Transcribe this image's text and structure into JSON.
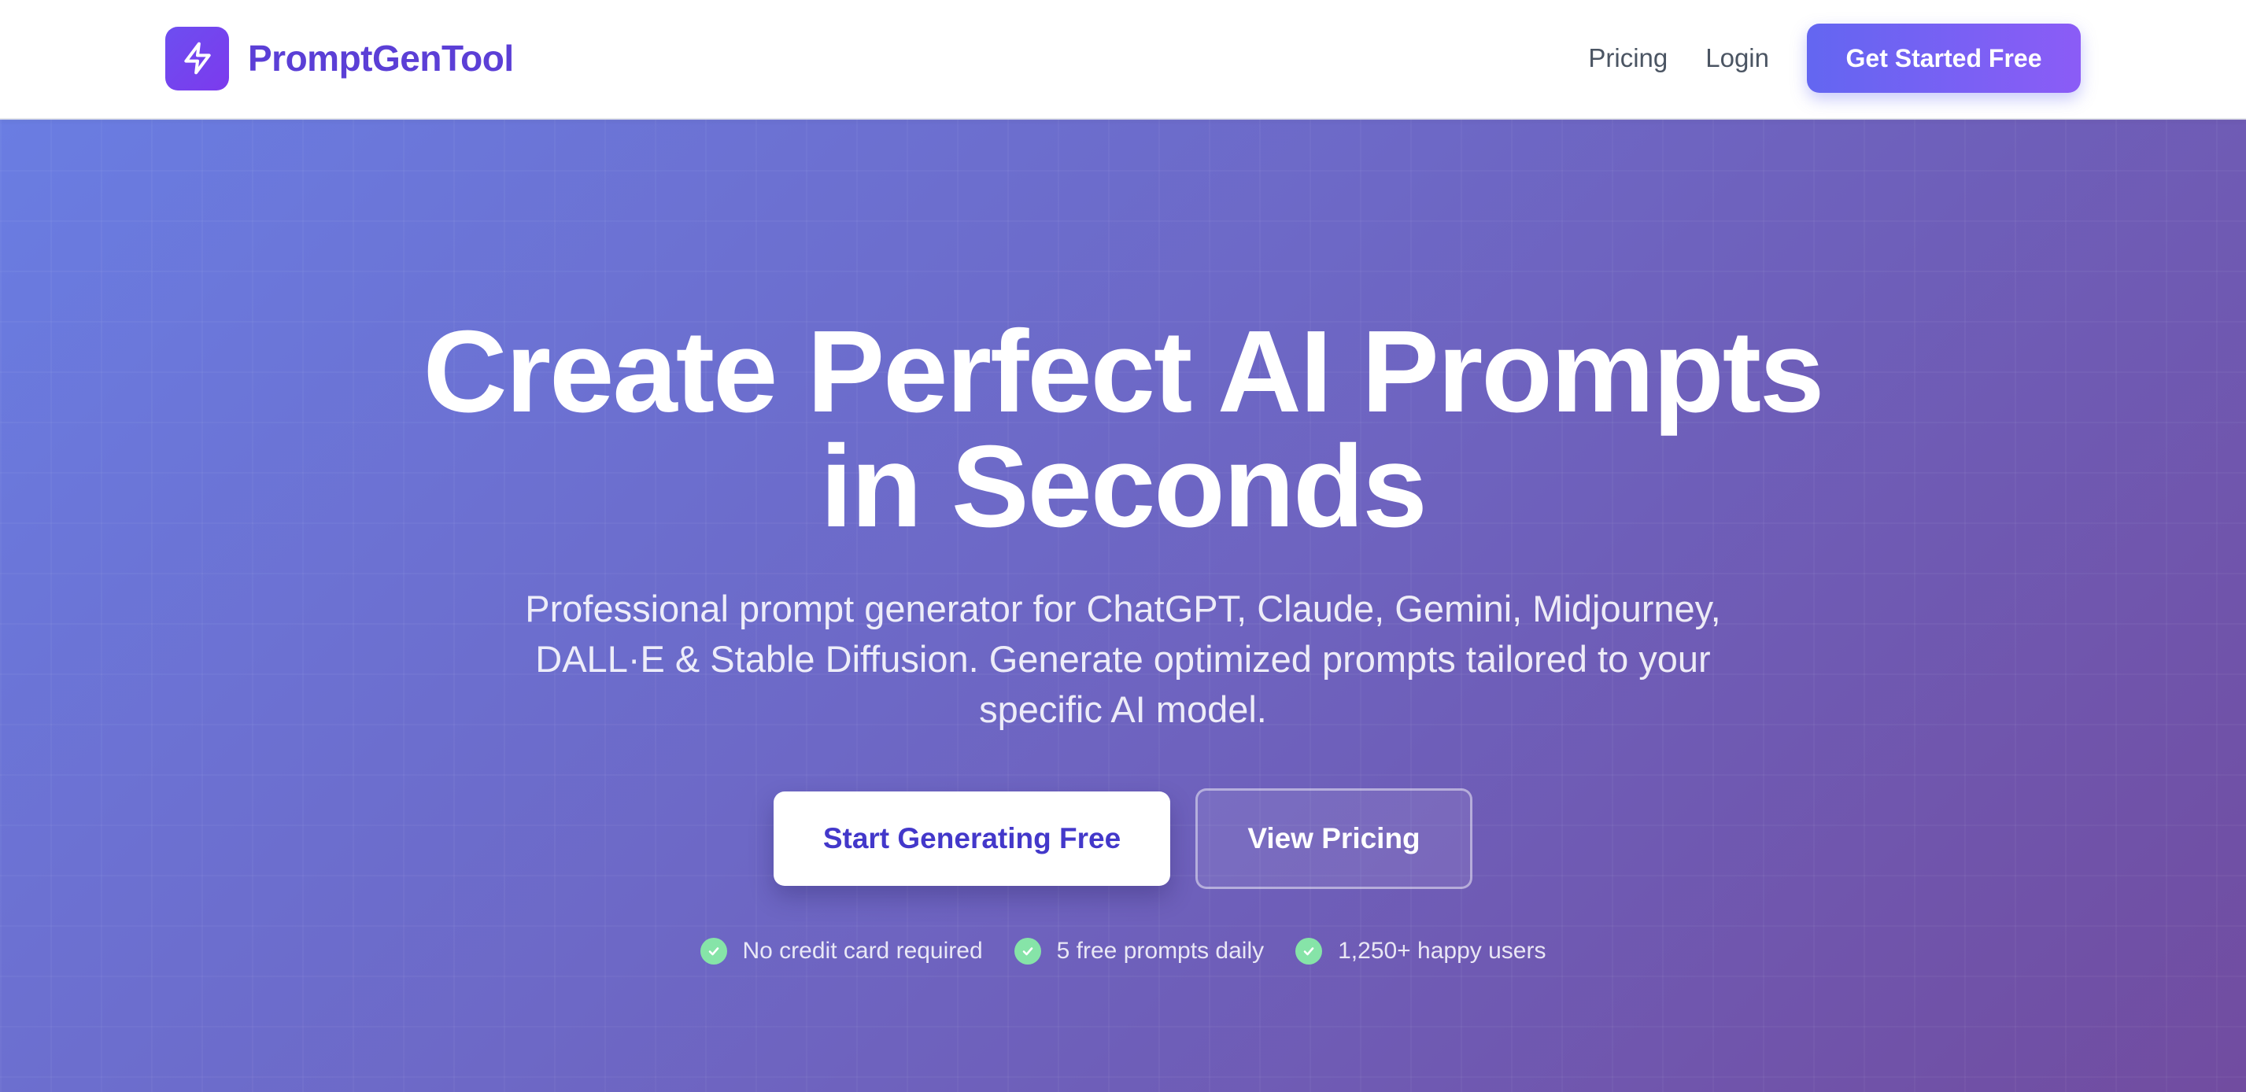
{
  "brand": {
    "name": "PromptGenTool",
    "icon": "lightning-bolt-icon"
  },
  "nav": {
    "links": [
      {
        "label": "Pricing"
      },
      {
        "label": "Login"
      }
    ],
    "cta_label": "Get Started Free"
  },
  "hero": {
    "title_line1": "Create Perfect AI Prompts",
    "title_line2": "in Seconds",
    "subtitle": "Professional prompt generator for ChatGPT, Claude, Gemini, Midjourney, DALL·E & Stable Diffusion. Generate optimized prompts tailored to your specific AI model.",
    "primary_cta": "Start Generating Free",
    "secondary_cta": "View Pricing",
    "trust_badges": [
      {
        "label": "No credit card required",
        "icon": "check-circle-icon"
      },
      {
        "label": "5 free prompts daily",
        "icon": "check-circle-icon"
      },
      {
        "label": "1,250+ happy users",
        "icon": "check-circle-icon"
      }
    ]
  },
  "colors": {
    "brand": "#5b3fd6",
    "cta_gradient_start": "#6366f1",
    "cta_gradient_end": "#8b5cf6",
    "hero_gradient_start": "#6a7de2",
    "hero_gradient_end": "#714ca0",
    "check": "#86e4a8"
  }
}
